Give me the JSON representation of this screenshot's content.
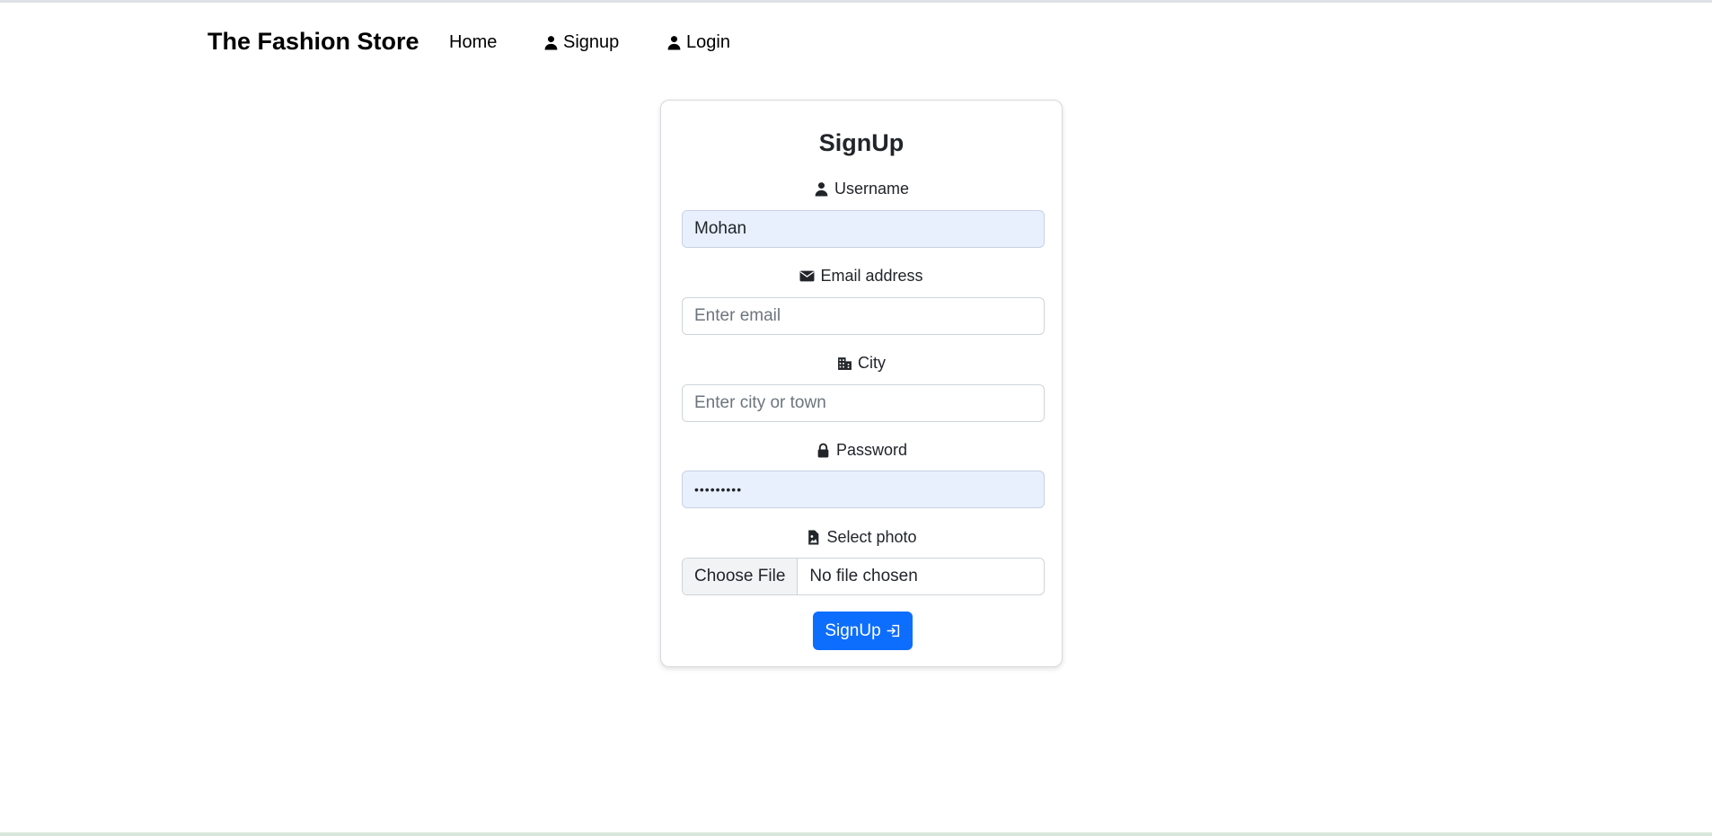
{
  "navbar": {
    "brand": "The Fashion Store",
    "links": [
      {
        "label": "Home",
        "icon": "none"
      },
      {
        "label": "Signup",
        "icon": "person-icon"
      },
      {
        "label": "Login",
        "icon": "person-icon"
      }
    ]
  },
  "form": {
    "title": "SignUp",
    "username": {
      "label": "Username",
      "icon": "person-icon",
      "value": "Mohan",
      "placeholder": ""
    },
    "email": {
      "label": "Email address",
      "icon": "envelope-icon",
      "value": "",
      "placeholder": "Enter email"
    },
    "city": {
      "label": "City",
      "icon": "buildings-icon",
      "value": "",
      "placeholder": "Enter city or town"
    },
    "password": {
      "label": "Password",
      "icon": "lock-icon",
      "value": "•••••••••"
    },
    "photo": {
      "label": "Select photo",
      "icon": "file-image-icon",
      "button": "Choose File",
      "status": "No file chosen"
    },
    "submit": {
      "label": "SignUp",
      "icon": "box-arrow-in-right-icon"
    }
  },
  "colors": {
    "primary": "#0d6efd",
    "autofill_bg": "#e8f0fe",
    "text": "#212529",
    "border": "#ced4da"
  }
}
